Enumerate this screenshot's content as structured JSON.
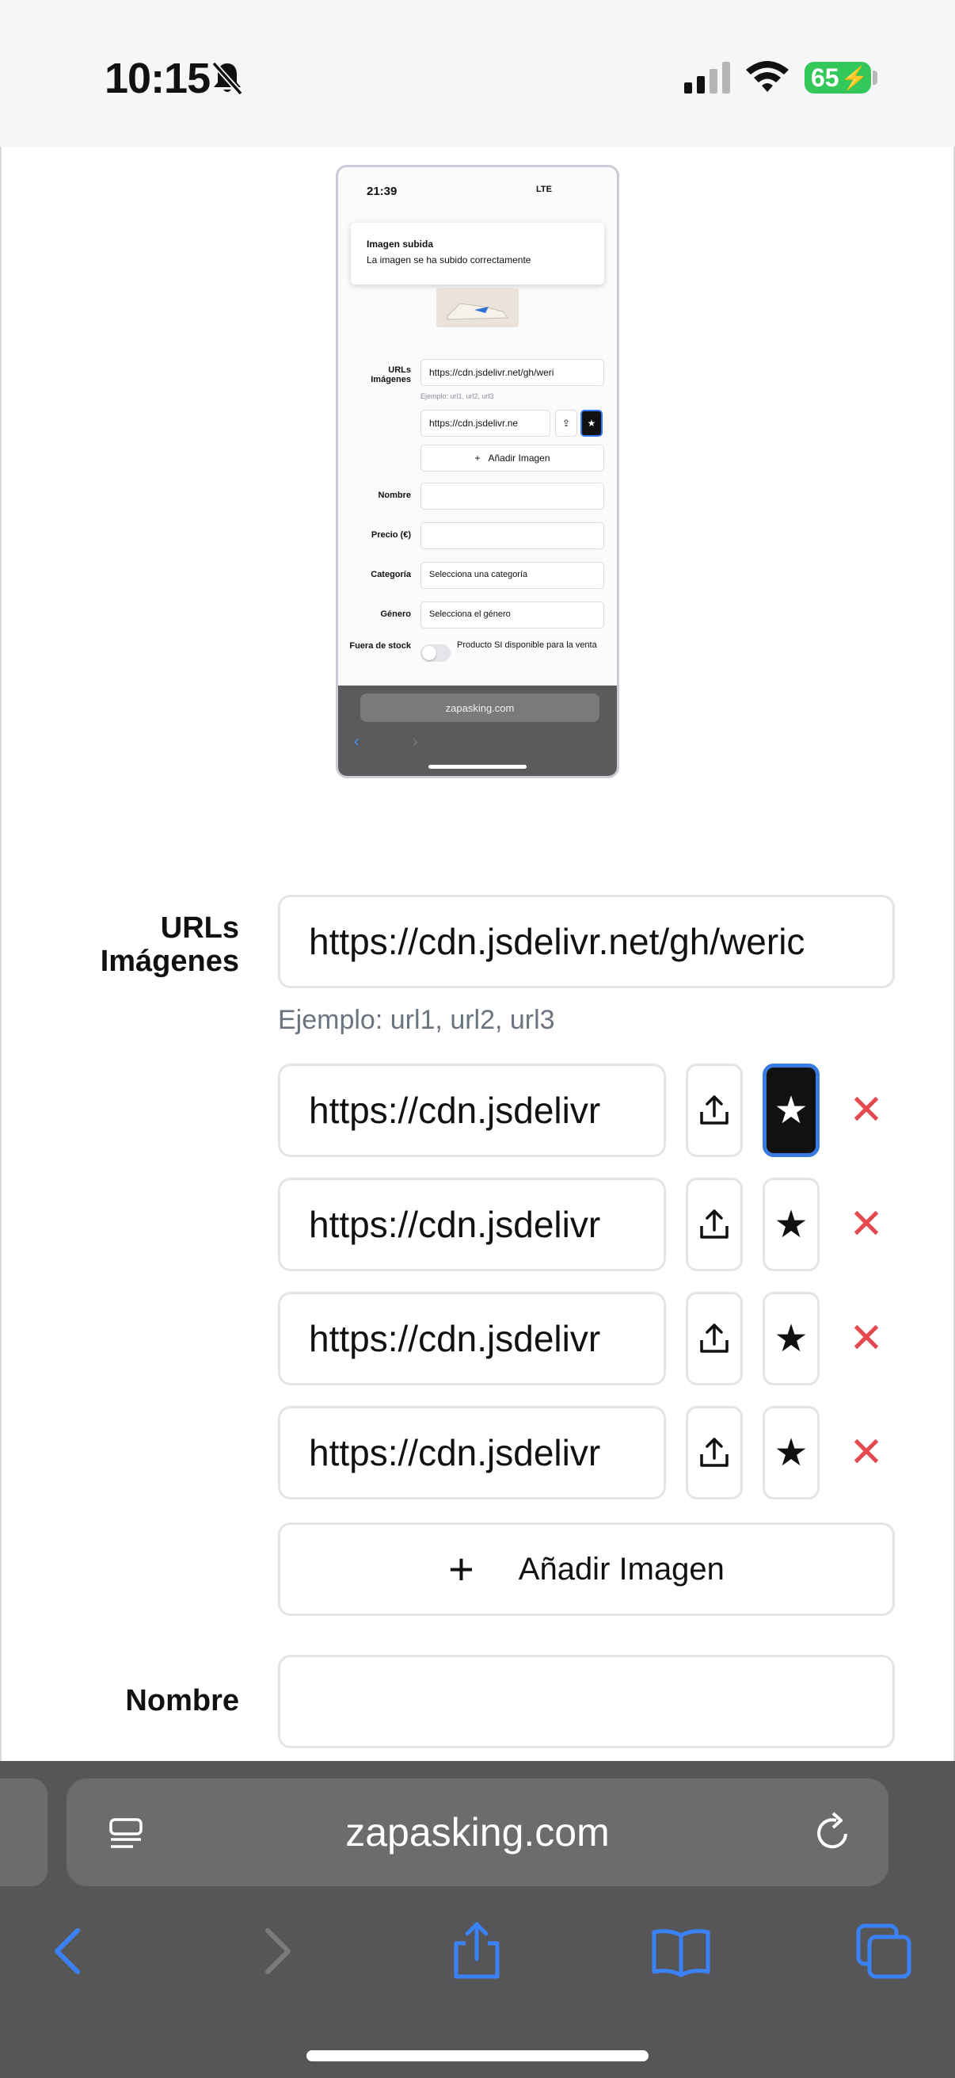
{
  "status_bar": {
    "time": "10:15",
    "battery": "65",
    "icons": [
      "bell-slash-icon",
      "cellular-signal-icon",
      "wifi-icon",
      "battery-charging-icon"
    ]
  },
  "thumbnail": {
    "time": "21:39",
    "network": "LTE",
    "toast_title": "Imagen subida",
    "toast_message": "La imagen se ha subido correctamente",
    "urls_label": "URLs Imágenes",
    "url_value": "https://cdn.jsdelivr.net/gh/weri",
    "hint": "Ejemplo: url1, url2, url3",
    "url_item_value": "https://cdn.jsdelivr.ne",
    "add_image": "Añadir Imagen",
    "nombre_label": "Nombre",
    "precio_label": "Precio (€)",
    "categoria_label": "Categoría",
    "categoria_placeholder": "Selecciona una categoría",
    "genero_label": "Género",
    "genero_placeholder": "Selecciona el género",
    "stock_label": "Fuera de stock",
    "stock_text": "Producto SI disponible para la venta",
    "domain": "zapasking.com"
  },
  "form": {
    "urls_label": "URLs Imágenes",
    "urls_value": "https://cdn.jsdelivr.net/gh/weric",
    "hint": "Ejemplo: url1, url2, url3",
    "image_rows": [
      {
        "url": "https://cdn.jsdelivr",
        "featured": true
      },
      {
        "url": "https://cdn.jsdelivr",
        "featured": false
      },
      {
        "url": "https://cdn.jsdelivr",
        "featured": false
      },
      {
        "url": "https://cdn.jsdelivr",
        "featured": false
      }
    ],
    "add_image_label": "Añadir Imagen",
    "nombre_label": "Nombre",
    "nombre_value": ""
  },
  "browser": {
    "domain": "zapasking.com",
    "accent": "#3b82f6"
  }
}
